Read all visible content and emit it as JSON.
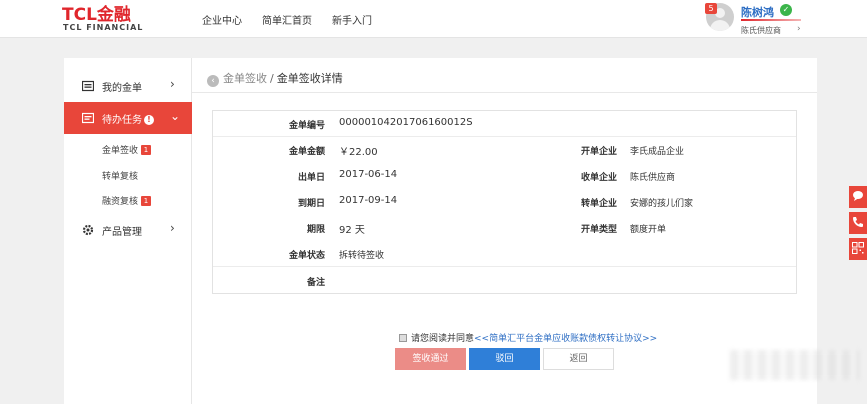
{
  "header": {
    "logo_main": "TCL金融",
    "logo_sub": "TCL FINANCIAL",
    "nav": [
      "企业中心",
      "简单汇首页",
      "新手入门"
    ],
    "user": {
      "badge": "5",
      "name": "陈树鸿",
      "company": "陈氏供应商",
      "verified_icon": "check-circle-icon"
    }
  },
  "sidebar": {
    "items": [
      {
        "label": "我的金单",
        "icon": "wallet-icon"
      },
      {
        "label": "待办任务",
        "icon": "task-icon",
        "active": true
      },
      {
        "label": "产品管理",
        "icon": "gear-icon"
      }
    ],
    "subitems": [
      {
        "label": "金单签收",
        "count": "1"
      },
      {
        "label": "转单复核",
        "count": ""
      },
      {
        "label": "融资复核",
        "count": "1"
      }
    ]
  },
  "breadcrumb": {
    "parent": "金单签收",
    "separator": "/",
    "current": "金单签收详情"
  },
  "detail": {
    "bill_no_label": "金单编号",
    "bill_no": "00000104201706160012S",
    "amount_label": "金单金额",
    "amount": "￥22.00",
    "open_company_label": "开单企业",
    "open_company": "李氏成品企业",
    "issue_date_label": "出单日",
    "issue_date": "2017-06-14",
    "receive_company_label": "收单企业",
    "receive_company": "陈氏供应商",
    "due_date_label": "到期日",
    "due_date": "2017-09-14",
    "transfer_company_label": "转单企业",
    "transfer_company": "安娜的孩儿们家",
    "term_label": "期限",
    "term": "92 天",
    "open_type_label": "开单类型",
    "open_type": "额度开单",
    "status_label": "金单状态",
    "status": "拆转待签收",
    "remark_label": "备注",
    "remark": ""
  },
  "agreement": {
    "prefix": "请您阅读并同意",
    "link": "<<简单汇平台金单应收账款债权转让协议>>"
  },
  "buttons": {
    "pass": "签收通过",
    "reject": "驳回",
    "back": "返回"
  },
  "float_tools": [
    "chat-icon",
    "phone-icon",
    "qrcode-icon"
  ]
}
